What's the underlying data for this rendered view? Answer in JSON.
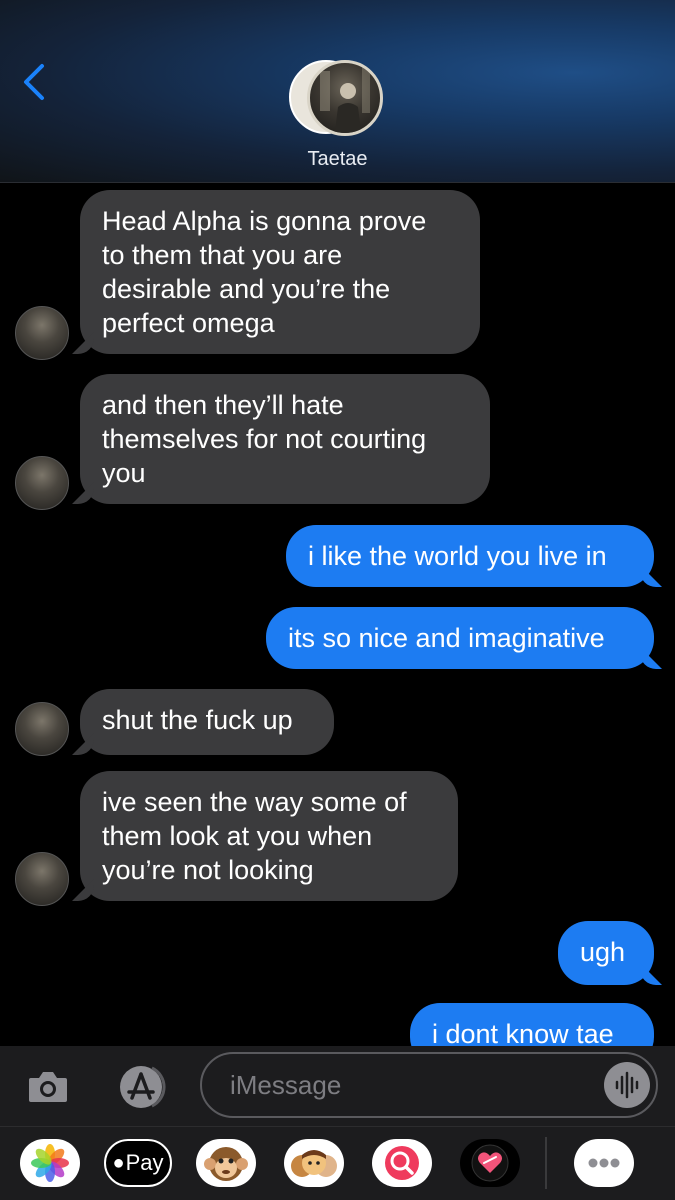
{
  "header": {
    "contact_name": "Taetae"
  },
  "messages": [
    {
      "direction": "incoming",
      "text_lines": [
        "Head Alpha is gonna prove",
        "to them that you are",
        "desirable and you’re the",
        "perfect omega"
      ]
    },
    {
      "direction": "incoming",
      "text_lines": [
        "and then they’ll hate",
        "themselves for not courting",
        "you"
      ]
    },
    {
      "direction": "outgoing",
      "text_lines": [
        "i like the world you live in"
      ]
    },
    {
      "direction": "outgoing",
      "text_lines": [
        "its so nice and imaginative"
      ]
    },
    {
      "direction": "incoming",
      "text_lines": [
        "shut the fuck up"
      ]
    },
    {
      "direction": "incoming",
      "text_lines": [
        "ive seen the way some of",
        "them look at you when",
        "you’re not looking"
      ]
    },
    {
      "direction": "outgoing",
      "text_lines": [
        "ugh"
      ]
    },
    {
      "direction": "outgoing",
      "text_lines": [
        "i dont know tae"
      ]
    }
  ],
  "composer": {
    "placeholder": "iMessage",
    "value": ""
  },
  "app_drawer": {
    "pay_label": "Pay",
    "items": [
      "photos-icon",
      "apple-pay-icon",
      "monkey-memoji-icon",
      "memoji-stickers-icon",
      "image-search-icon",
      "digital-touch-icon",
      "more-apps-icon"
    ]
  },
  "colors": {
    "incoming_bubble": "#3b3b3d",
    "outgoing_bubble": "#1d7cf2",
    "accent": "#1a82fb"
  }
}
